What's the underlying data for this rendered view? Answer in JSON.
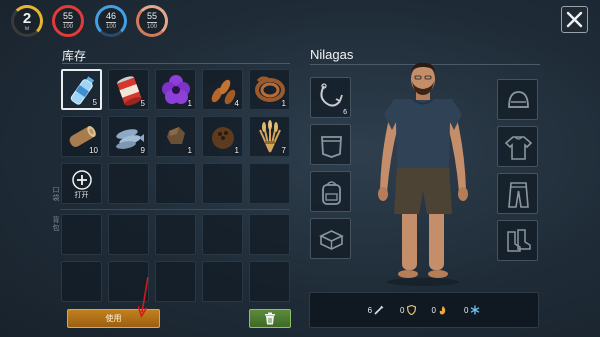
{
  "status": {
    "level": {
      "value": "2",
      "label": "lvl",
      "color": "#e9b52f"
    },
    "health": {
      "value": "55",
      "max": "100",
      "color": "#e33a3a"
    },
    "water": {
      "value": "46",
      "max": "100",
      "color": "#41a0e6"
    },
    "food": {
      "value": "55",
      "max": "100",
      "color": "#e3a88a"
    }
  },
  "inventory": {
    "title": "库存",
    "side_label_top": "口袋",
    "side_label_bottom": "背包",
    "items": [
      {
        "name": "water-bottle-icon",
        "count": "5"
      },
      {
        "name": "canned-food-icon",
        "count": "5"
      },
      {
        "name": "purple-flower-icon",
        "count": "1"
      },
      {
        "name": "seeds-icon",
        "count": "4"
      },
      {
        "name": "rope-icon",
        "count": "1"
      },
      {
        "name": "wood-log-icon",
        "count": "10"
      },
      {
        "name": "fish-icon",
        "count": "9"
      },
      {
        "name": "stone-icon",
        "count": "1"
      },
      {
        "name": "coconut-icon",
        "count": "1"
      },
      {
        "name": "wheat-bundle-icon",
        "count": "7"
      }
    ],
    "open_label": "打开",
    "use_button": "使用"
  },
  "character": {
    "name": "Nilagas",
    "equipped_hook_count": "6",
    "stats": [
      {
        "icon": "attack-icon",
        "value": "6",
        "color": "#d8d8d8"
      },
      {
        "icon": "armor-icon",
        "value": "0",
        "color": "#e3c37a"
      },
      {
        "icon": "heat-icon",
        "value": "0",
        "color": "#f0a73a"
      },
      {
        "icon": "cold-icon",
        "value": "0",
        "color": "#6fc3f3"
      }
    ]
  }
}
